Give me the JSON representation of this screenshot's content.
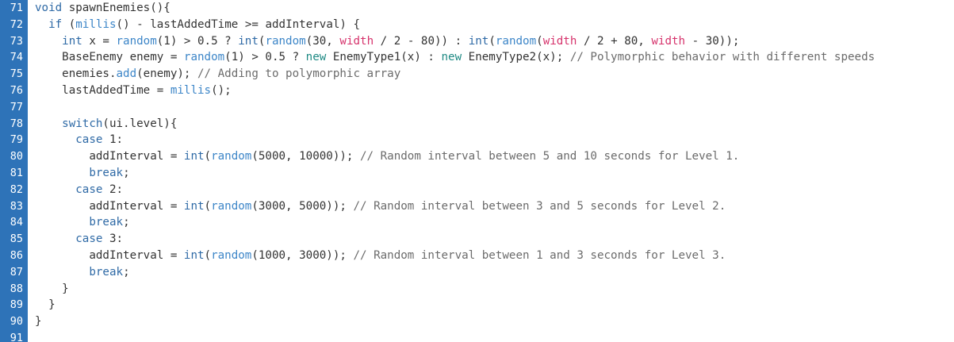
{
  "colors": {
    "gutter_bg": "#2e73b8",
    "gutter_text": "#ffffff",
    "keyword": "#2f6aa6",
    "function": "#3d86c8",
    "builtin_var": "#d6336c",
    "new_keyword": "#1f8a84",
    "comment": "#6b6b6b",
    "default": "#333333"
  },
  "editor": {
    "lines": [
      {
        "num": "71",
        "tokens": [
          {
            "t": "void",
            "c": "kw"
          },
          {
            "t": " spawnEnemies(){",
            "c": ""
          }
        ]
      },
      {
        "num": "72",
        "tokens": [
          {
            "t": "  ",
            "c": ""
          },
          {
            "t": "if",
            "c": "kw"
          },
          {
            "t": " (",
            "c": ""
          },
          {
            "t": "millis",
            "c": "fn"
          },
          {
            "t": "() - lastAddedTime >= addInterval) {",
            "c": ""
          }
        ]
      },
      {
        "num": "73",
        "tokens": [
          {
            "t": "    ",
            "c": ""
          },
          {
            "t": "int",
            "c": "kw"
          },
          {
            "t": " x = ",
            "c": ""
          },
          {
            "t": "random",
            "c": "fn"
          },
          {
            "t": "(1) > 0.5 ? ",
            "c": ""
          },
          {
            "t": "int",
            "c": "kw"
          },
          {
            "t": "(",
            "c": ""
          },
          {
            "t": "random",
            "c": "fn"
          },
          {
            "t": "(30, ",
            "c": ""
          },
          {
            "t": "width",
            "c": "var"
          },
          {
            "t": " / 2 - 80)) : ",
            "c": ""
          },
          {
            "t": "int",
            "c": "kw"
          },
          {
            "t": "(",
            "c": ""
          },
          {
            "t": "random",
            "c": "fn"
          },
          {
            "t": "(",
            "c": ""
          },
          {
            "t": "width",
            "c": "var"
          },
          {
            "t": " / 2 + 80, ",
            "c": ""
          },
          {
            "t": "width",
            "c": "var"
          },
          {
            "t": " - 30));",
            "c": ""
          }
        ]
      },
      {
        "num": "74",
        "tokens": [
          {
            "t": "    BaseEnemy enemy = ",
            "c": ""
          },
          {
            "t": "random",
            "c": "fn"
          },
          {
            "t": "(1) > 0.5 ? ",
            "c": ""
          },
          {
            "t": "new",
            "c": "cls"
          },
          {
            "t": " EnemyType1(x) : ",
            "c": ""
          },
          {
            "t": "new",
            "c": "cls"
          },
          {
            "t": " EnemyType2(x); ",
            "c": ""
          },
          {
            "t": "// Polymorphic behavior with different speeds",
            "c": "cm"
          }
        ]
      },
      {
        "num": "75",
        "tokens": [
          {
            "t": "    enemies.",
            "c": ""
          },
          {
            "t": "add",
            "c": "fn"
          },
          {
            "t": "(enemy); ",
            "c": ""
          },
          {
            "t": "// Adding to polymorphic array",
            "c": "cm"
          }
        ]
      },
      {
        "num": "76",
        "tokens": [
          {
            "t": "    lastAddedTime = ",
            "c": ""
          },
          {
            "t": "millis",
            "c": "fn"
          },
          {
            "t": "();",
            "c": ""
          }
        ]
      },
      {
        "num": "77",
        "tokens": []
      },
      {
        "num": "78",
        "tokens": [
          {
            "t": "    ",
            "c": ""
          },
          {
            "t": "switch",
            "c": "kw"
          },
          {
            "t": "(ui.level){",
            "c": ""
          }
        ]
      },
      {
        "num": "79",
        "tokens": [
          {
            "t": "      ",
            "c": ""
          },
          {
            "t": "case",
            "c": "kw"
          },
          {
            "t": " 1:",
            "c": ""
          }
        ]
      },
      {
        "num": "80",
        "tokens": [
          {
            "t": "        addInterval = ",
            "c": ""
          },
          {
            "t": "int",
            "c": "kw"
          },
          {
            "t": "(",
            "c": ""
          },
          {
            "t": "random",
            "c": "fn"
          },
          {
            "t": "(5000, 10000)); ",
            "c": ""
          },
          {
            "t": "// Random interval between 5 and 10 seconds for Level 1.",
            "c": "cm"
          }
        ]
      },
      {
        "num": "81",
        "tokens": [
          {
            "t": "        ",
            "c": ""
          },
          {
            "t": "break",
            "c": "kw"
          },
          {
            "t": ";",
            "c": ""
          }
        ]
      },
      {
        "num": "82",
        "tokens": [
          {
            "t": "      ",
            "c": ""
          },
          {
            "t": "case",
            "c": "kw"
          },
          {
            "t": " 2:",
            "c": ""
          }
        ]
      },
      {
        "num": "83",
        "tokens": [
          {
            "t": "        addInterval = ",
            "c": ""
          },
          {
            "t": "int",
            "c": "kw"
          },
          {
            "t": "(",
            "c": ""
          },
          {
            "t": "random",
            "c": "fn"
          },
          {
            "t": "(3000, 5000)); ",
            "c": ""
          },
          {
            "t": "// Random interval between 3 and 5 seconds for Level 2.",
            "c": "cm"
          }
        ]
      },
      {
        "num": "84",
        "tokens": [
          {
            "t": "        ",
            "c": ""
          },
          {
            "t": "break",
            "c": "kw"
          },
          {
            "t": ";",
            "c": ""
          }
        ]
      },
      {
        "num": "85",
        "tokens": [
          {
            "t": "      ",
            "c": ""
          },
          {
            "t": "case",
            "c": "kw"
          },
          {
            "t": " 3:",
            "c": ""
          }
        ]
      },
      {
        "num": "86",
        "tokens": [
          {
            "t": "        addInterval = ",
            "c": ""
          },
          {
            "t": "int",
            "c": "kw"
          },
          {
            "t": "(",
            "c": ""
          },
          {
            "t": "random",
            "c": "fn"
          },
          {
            "t": "(1000, 3000)); ",
            "c": ""
          },
          {
            "t": "// Random interval between 1 and 3 seconds for Level 3.",
            "c": "cm"
          }
        ]
      },
      {
        "num": "87",
        "tokens": [
          {
            "t": "        ",
            "c": ""
          },
          {
            "t": "break",
            "c": "kw"
          },
          {
            "t": ";",
            "c": ""
          }
        ]
      },
      {
        "num": "88",
        "tokens": [
          {
            "t": "    }",
            "c": ""
          }
        ]
      },
      {
        "num": "89",
        "tokens": [
          {
            "t": "  }",
            "c": ""
          }
        ]
      },
      {
        "num": "90",
        "tokens": [
          {
            "t": "}",
            "c": ""
          }
        ]
      },
      {
        "num": "91",
        "tokens": []
      }
    ]
  }
}
